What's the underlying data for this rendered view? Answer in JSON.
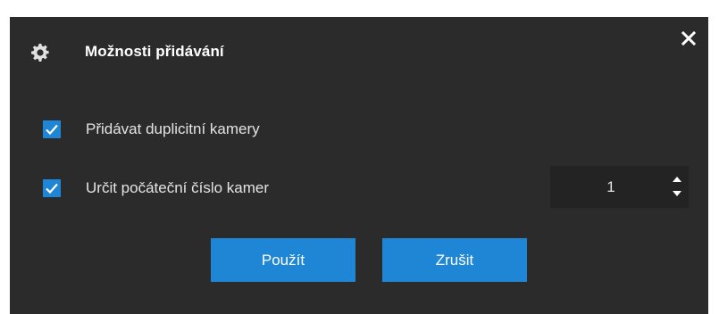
{
  "dialog": {
    "title": "Možnosti přidávání",
    "title_icon": "gear-icon",
    "close_icon": "close-icon"
  },
  "options": [
    {
      "label": "Přidávat duplicitní kamery",
      "checked": true
    },
    {
      "label": "Určit počáteční číslo kamer",
      "checked": true
    }
  ],
  "start_number": {
    "value": "1"
  },
  "buttons": {
    "apply": "Použít",
    "cancel": "Zrušit"
  },
  "colors": {
    "background": "#2b2b2b",
    "accent": "#1f86d6",
    "input_background": "#232323",
    "text": "#e4e4e4"
  }
}
